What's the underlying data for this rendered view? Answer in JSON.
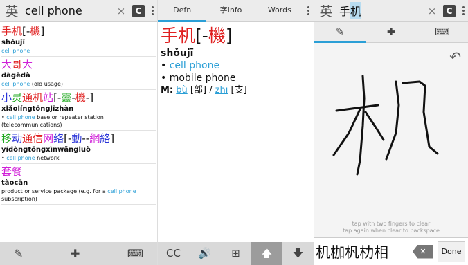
{
  "left": {
    "lang_label": "英",
    "search_value": "cell phone",
    "clear_icon": "×",
    "cbtn_label": "C",
    "results": [
      {
        "hz": [
          "手",
          "机",
          "[-",
          "機",
          "]"
        ],
        "hzc": [
          "red",
          "red",
          "blk",
          "red",
          "blk"
        ],
        "py": "shǒujī",
        "defs": [
          {
            "t": "cell phone",
            "c": "blue"
          }
        ]
      },
      {
        "hz": [
          "大",
          "哥",
          "大"
        ],
        "hzc": [
          "mag",
          "red",
          "mag"
        ],
        "py": "dàgēdà",
        "defs": [
          {
            "t": "cell phone",
            "c": "blue"
          },
          {
            "t": " (old usage)",
            "c": "blk"
          }
        ]
      },
      {
        "hz": [
          "小",
          "灵",
          "通",
          "机",
          "站",
          "[-",
          "靈",
          "-",
          "機",
          "-]"
        ],
        "hzc": [
          "bl",
          "grn",
          "red",
          "red",
          "mag",
          "blk",
          "grn",
          "blk",
          "red",
          "blk"
        ],
        "py": "xiǎolíngtōngjīzhàn",
        "defs": [
          {
            "t": "• ",
            "c": "blk"
          },
          {
            "t": "cell phone",
            "c": "blue"
          },
          {
            "t": " base or repeater station (telecommunications)",
            "c": "blk"
          }
        ]
      },
      {
        "hz": [
          "移",
          "动",
          "通",
          "信",
          "网",
          "络",
          "[-",
          "動",
          "--",
          "網",
          "絡",
          "]"
        ],
        "hzc": [
          "grn",
          "bl",
          "red",
          "red",
          "mag",
          "bl",
          "blk",
          "bl",
          "blk",
          "mag",
          "bl",
          "blk"
        ],
        "py": "yídòngtōngxìnwǎngluò",
        "defs": [
          {
            "t": "• ",
            "c": "blk"
          },
          {
            "t": "cell phone",
            "c": "blue"
          },
          {
            "t": " network",
            "c": "blk"
          }
        ]
      },
      {
        "hz": [
          "套",
          "餐"
        ],
        "hzc": [
          "mag",
          "mag"
        ],
        "py": "tàocān",
        "defs": [
          {
            "t": "product or service package (e.g. for a ",
            "c": "blk"
          },
          {
            "t": "cell phone",
            "c": "blue"
          },
          {
            "t": " subscription)",
            "c": "blk"
          }
        ]
      }
    ],
    "bottom": [
      "brush-icon",
      "puzzle-icon",
      "keyboard-icon"
    ]
  },
  "middle": {
    "tabs": [
      "Defn",
      "字Info",
      "Words"
    ],
    "hz": [
      "手",
      "机",
      "[-",
      "機",
      "]"
    ],
    "hzc": [
      "red",
      "red",
      "blk",
      "red",
      "blk"
    ],
    "py": "shǒujī",
    "defs": [
      "• ",
      "cell phone",
      "• mobile phone"
    ],
    "m_label": "M:",
    "m_link1": "bù",
    "m_mid": " [部] / ",
    "m_link2": "zhī",
    "m_tail": " [支]",
    "bottom": [
      "CC",
      "speaker-icon",
      "plus-icon",
      "up-arrow-icon",
      "down-arrow-icon"
    ]
  },
  "right": {
    "lang_label": "英",
    "search_prefix": "手",
    "search_sel": "机",
    "clear_icon": "×",
    "cbtn_label": "C",
    "tabs": [
      "brush-icon",
      "puzzle-icon",
      "keyboard-icon"
    ],
    "hint1": "tap with two fingers to clear",
    "hint2": "tap again when clear to backspace",
    "candidates": "机枷杋朸相",
    "done_label": "Done"
  }
}
